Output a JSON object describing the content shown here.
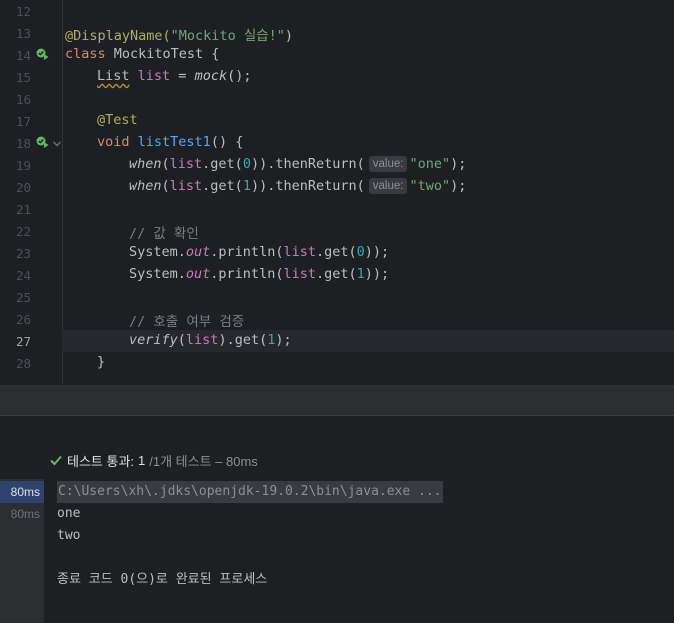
{
  "editor": {
    "lines": [
      {
        "num": "12"
      },
      {
        "num": "13",
        "annotation": "@DisplayName(",
        "string": "\"Mockito 실습!\"",
        "close": ")"
      },
      {
        "num": "14",
        "keyword": "class",
        "name": " MockitoTest {"
      },
      {
        "num": "15",
        "type": "List",
        "var": "list",
        "eq": " = ",
        "method": "mock",
        "end": "();"
      },
      {
        "num": "16"
      },
      {
        "num": "17",
        "annotation": "@Test"
      },
      {
        "num": "18",
        "keyword": "void",
        "method": "listTest1",
        "rest": "() {"
      },
      {
        "num": "19",
        "method": "when",
        "open": "(",
        "var": "list",
        "mid": ".get(",
        "arg": "0",
        "mid2": ")).thenReturn(",
        "hint": "value:",
        "string": "\"one\"",
        "end": ");"
      },
      {
        "num": "20",
        "method": "when",
        "open": "(",
        "var": "list",
        "mid": ".get(",
        "arg": "1",
        "mid2": ")).thenReturn(",
        "hint": "value:",
        "string": "\"two\"",
        "end": ");"
      },
      {
        "num": "21"
      },
      {
        "num": "22",
        "comment": "// 값 확인"
      },
      {
        "num": "23",
        "cls": "System.",
        "field": "out",
        "mid": ".println(",
        "var": "list",
        "mid2": ".get(",
        "arg": "0",
        "end": "));"
      },
      {
        "num": "24",
        "cls": "System.",
        "field": "out",
        "mid": ".println(",
        "var": "list",
        "mid2": ".get(",
        "arg": "1",
        "end": "));"
      },
      {
        "num": "25"
      },
      {
        "num": "26",
        "comment": "// 호출 여부 검증"
      },
      {
        "num": "27",
        "method": "verify",
        "open": "(",
        "var": "list",
        "mid": ").get(",
        "arg": "1",
        "end": ");"
      },
      {
        "num": "28",
        "brace": "}"
      }
    ]
  },
  "test_status": {
    "label": "테스트 통과:",
    "count": "1",
    "rest": "/1개 테스트 – 80ms"
  },
  "console": {
    "times": [
      "80ms",
      "80ms"
    ],
    "lines": [
      "C:\\Users\\xh\\.jdks\\openjdk-19.0.2\\bin\\java.exe ...",
      "one",
      "two",
      "",
      "종료 코드 0(으)로 완료된 프로세스"
    ]
  },
  "colors": {
    "background": "#1e1f22",
    "keyword": "#cf8e6d",
    "string": "#6aab73",
    "number": "#2aacb8",
    "method": "#56a8f5",
    "field": "#c77dbb",
    "annotation": "#b3ae60",
    "success": "#5fb865"
  }
}
